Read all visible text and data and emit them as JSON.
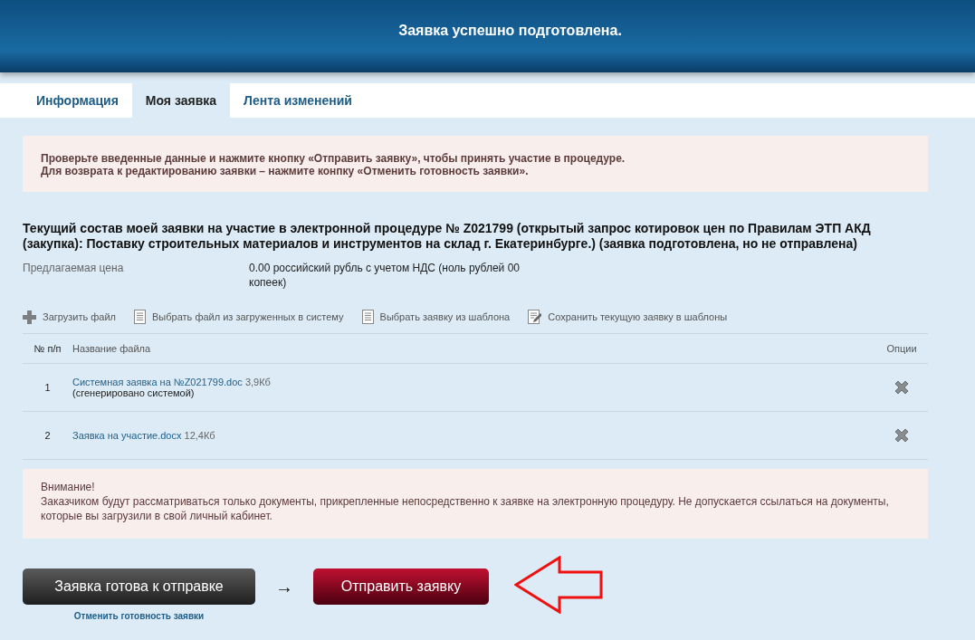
{
  "header": {
    "title": "Заявка успешно подготовлена."
  },
  "tabs": [
    {
      "label": "Информация",
      "selected": false
    },
    {
      "label": "Моя заявка",
      "selected": true
    },
    {
      "label": "Лента изменений",
      "selected": false
    }
  ],
  "notice": {
    "lines": [
      "Проверьте введенные данные и нажмите кнопку «Отправить заявку», чтобы принять участие в процедуре.",
      "Для возврата к редактированию заявки – нажмите конпку «Отменить готовность заявки»."
    ]
  },
  "heading": "Текущий состав моей заявки на участие в электронной процедуре № Z021799 (открытый запрос котировок цен по Правилам ЭТП АКД (закупка): Поставку строительных материалов и инструментов на склад г. Екатеринбурге.) (заявка подготовлена, но не отправлена)",
  "price": {
    "label": "Предлагаемая цена",
    "value": "0.00 российский рубль с учетом НДС (ноль рублей 00 копеек)"
  },
  "toolbar": [
    {
      "kind": "plus",
      "label": "Загрузить файл"
    },
    {
      "kind": "doc",
      "label": "Выбрать файл из загруженных в систему"
    },
    {
      "kind": "doc",
      "label": "Выбрать заявку из шаблона"
    },
    {
      "kind": "edit",
      "label": "Сохранить текущую заявку в шаблоны"
    }
  ],
  "table": {
    "columns": [
      "№ п/п",
      "Название файла",
      "Опции"
    ],
    "rows": [
      {
        "number": "1",
        "file": "Системная заявка на №Z021799.doc",
        "size": "3,9Кб",
        "note": "(сгенерировано системой)"
      },
      {
        "number": "2",
        "file": "Заявка на участие.docx",
        "size": "12,4Кб"
      }
    ]
  },
  "warning": {
    "title": "Внимание!",
    "text": "Заказчиком будут рассматриваться только документы, прикрепленные непосредственно к заявке на электронную процедуру. Не допускается ссылаться на документы, которые вы загрузили в свой личный кабинет."
  },
  "ready_button": "Заявка готова к отправке",
  "cancel_link": "Отменить готовность заявки",
  "arrow": "→",
  "send_button": "Отправить заявку"
}
